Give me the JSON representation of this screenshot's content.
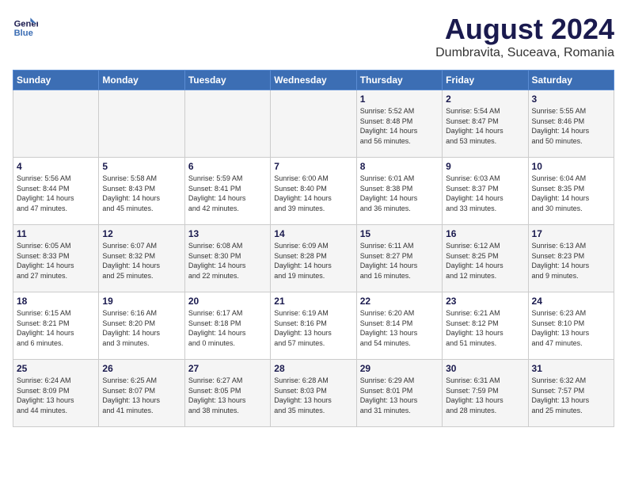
{
  "header": {
    "logo_line1": "General",
    "logo_line2": "Blue",
    "title": "August 2024",
    "subtitle": "Dumbravita, Suceava, Romania"
  },
  "weekdays": [
    "Sunday",
    "Monday",
    "Tuesday",
    "Wednesday",
    "Thursday",
    "Friday",
    "Saturday"
  ],
  "weeks": [
    [
      {
        "day": "",
        "info": ""
      },
      {
        "day": "",
        "info": ""
      },
      {
        "day": "",
        "info": ""
      },
      {
        "day": "",
        "info": ""
      },
      {
        "day": "1",
        "info": "Sunrise: 5:52 AM\nSunset: 8:48 PM\nDaylight: 14 hours\nand 56 minutes."
      },
      {
        "day": "2",
        "info": "Sunrise: 5:54 AM\nSunset: 8:47 PM\nDaylight: 14 hours\nand 53 minutes."
      },
      {
        "day": "3",
        "info": "Sunrise: 5:55 AM\nSunset: 8:46 PM\nDaylight: 14 hours\nand 50 minutes."
      }
    ],
    [
      {
        "day": "4",
        "info": "Sunrise: 5:56 AM\nSunset: 8:44 PM\nDaylight: 14 hours\nand 47 minutes."
      },
      {
        "day": "5",
        "info": "Sunrise: 5:58 AM\nSunset: 8:43 PM\nDaylight: 14 hours\nand 45 minutes."
      },
      {
        "day": "6",
        "info": "Sunrise: 5:59 AM\nSunset: 8:41 PM\nDaylight: 14 hours\nand 42 minutes."
      },
      {
        "day": "7",
        "info": "Sunrise: 6:00 AM\nSunset: 8:40 PM\nDaylight: 14 hours\nand 39 minutes."
      },
      {
        "day": "8",
        "info": "Sunrise: 6:01 AM\nSunset: 8:38 PM\nDaylight: 14 hours\nand 36 minutes."
      },
      {
        "day": "9",
        "info": "Sunrise: 6:03 AM\nSunset: 8:37 PM\nDaylight: 14 hours\nand 33 minutes."
      },
      {
        "day": "10",
        "info": "Sunrise: 6:04 AM\nSunset: 8:35 PM\nDaylight: 14 hours\nand 30 minutes."
      }
    ],
    [
      {
        "day": "11",
        "info": "Sunrise: 6:05 AM\nSunset: 8:33 PM\nDaylight: 14 hours\nand 27 minutes."
      },
      {
        "day": "12",
        "info": "Sunrise: 6:07 AM\nSunset: 8:32 PM\nDaylight: 14 hours\nand 25 minutes."
      },
      {
        "day": "13",
        "info": "Sunrise: 6:08 AM\nSunset: 8:30 PM\nDaylight: 14 hours\nand 22 minutes."
      },
      {
        "day": "14",
        "info": "Sunrise: 6:09 AM\nSunset: 8:28 PM\nDaylight: 14 hours\nand 19 minutes."
      },
      {
        "day": "15",
        "info": "Sunrise: 6:11 AM\nSunset: 8:27 PM\nDaylight: 14 hours\nand 16 minutes."
      },
      {
        "day": "16",
        "info": "Sunrise: 6:12 AM\nSunset: 8:25 PM\nDaylight: 14 hours\nand 12 minutes."
      },
      {
        "day": "17",
        "info": "Sunrise: 6:13 AM\nSunset: 8:23 PM\nDaylight: 14 hours\nand 9 minutes."
      }
    ],
    [
      {
        "day": "18",
        "info": "Sunrise: 6:15 AM\nSunset: 8:21 PM\nDaylight: 14 hours\nand 6 minutes."
      },
      {
        "day": "19",
        "info": "Sunrise: 6:16 AM\nSunset: 8:20 PM\nDaylight: 14 hours\nand 3 minutes."
      },
      {
        "day": "20",
        "info": "Sunrise: 6:17 AM\nSunset: 8:18 PM\nDaylight: 14 hours\nand 0 minutes."
      },
      {
        "day": "21",
        "info": "Sunrise: 6:19 AM\nSunset: 8:16 PM\nDaylight: 13 hours\nand 57 minutes."
      },
      {
        "day": "22",
        "info": "Sunrise: 6:20 AM\nSunset: 8:14 PM\nDaylight: 13 hours\nand 54 minutes."
      },
      {
        "day": "23",
        "info": "Sunrise: 6:21 AM\nSunset: 8:12 PM\nDaylight: 13 hours\nand 51 minutes."
      },
      {
        "day": "24",
        "info": "Sunrise: 6:23 AM\nSunset: 8:10 PM\nDaylight: 13 hours\nand 47 minutes."
      }
    ],
    [
      {
        "day": "25",
        "info": "Sunrise: 6:24 AM\nSunset: 8:09 PM\nDaylight: 13 hours\nand 44 minutes."
      },
      {
        "day": "26",
        "info": "Sunrise: 6:25 AM\nSunset: 8:07 PM\nDaylight: 13 hours\nand 41 minutes."
      },
      {
        "day": "27",
        "info": "Sunrise: 6:27 AM\nSunset: 8:05 PM\nDaylight: 13 hours\nand 38 minutes."
      },
      {
        "day": "28",
        "info": "Sunrise: 6:28 AM\nSunset: 8:03 PM\nDaylight: 13 hours\nand 35 minutes."
      },
      {
        "day": "29",
        "info": "Sunrise: 6:29 AM\nSunset: 8:01 PM\nDaylight: 13 hours\nand 31 minutes."
      },
      {
        "day": "30",
        "info": "Sunrise: 6:31 AM\nSunset: 7:59 PM\nDaylight: 13 hours\nand 28 minutes."
      },
      {
        "day": "31",
        "info": "Sunrise: 6:32 AM\nSunset: 7:57 PM\nDaylight: 13 hours\nand 25 minutes."
      }
    ]
  ]
}
